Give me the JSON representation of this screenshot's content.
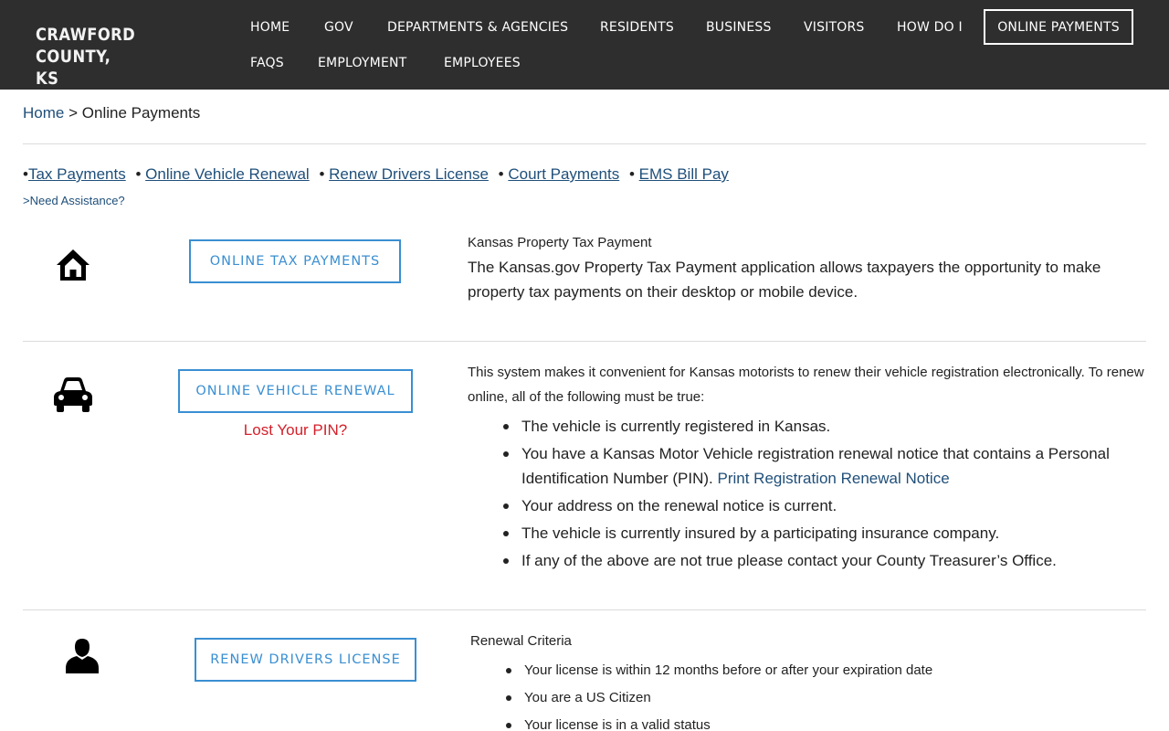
{
  "header": {
    "logo_line1": "CRAWFORD COUNTY,",
    "logo_line2": "KS",
    "nav": [
      "HOME",
      "GOV",
      "DEPARTMENTS & AGENCIES",
      "RESIDENTS",
      "BUSINESS",
      "VISITORS",
      "HOW DO I",
      "FAQS",
      "EMPLOYMENT",
      "EMPLOYEES"
    ],
    "nav_highlight": "ONLINE PAYMENTS"
  },
  "breadcrumb": {
    "home": "Home",
    "sep": ">",
    "current": "Online Payments"
  },
  "quicklinks": {
    "bullet": "•",
    "items": [
      "Tax Payments",
      "Online Vehicle Renewal",
      "Renew Drivers License",
      "Court Payments",
      "EMS Bill Pay"
    ],
    "assist": ">Need Assistance?"
  },
  "tax": {
    "icon": "home-icon",
    "button": "ONLINE TAX PAYMENTS",
    "heading": "Kansas Property Tax Payment",
    "body": "The Kansas.gov Property Tax Payment application allows taxpayers the opportunity to make property tax payments on their desktop or mobile device."
  },
  "vehicle": {
    "icon": "car-icon",
    "button": "ONLINE VEHICLE RENEWAL",
    "lost_pin": "Lost Your PIN?",
    "intro": "This system makes it convenient for Kansas motorists to renew their vehicle registration electronically.  To renew online, all of the following must be true:",
    "items": [
      "The vehicle is currently registered in Kansas.",
      "You have a Kansas Motor Vehicle registration renewal notice that contains a Personal Identification Number (PIN).",
      "Your address on the renewal notice is current.",
      "The vehicle is currently insured by a participating insurance company.",
      "If any of the above are not true please contact your County Treasurer’s Office."
    ],
    "print_link": "Print Registration Renewal Notice"
  },
  "license": {
    "icon": "person-icon",
    "button": "RENEW DRIVERS LICENSE",
    "heading": "Renewal Criteria",
    "items": [
      "Your license is within 12 months before or after your expiration date",
      "You are a US Citizen",
      "Your license is in a valid status"
    ]
  },
  "colors": {
    "header_bg": "#2e2e2e",
    "button_blue": "#3a8fd2",
    "link_blue": "#1f4f7a",
    "alert_red": "#d4202a"
  }
}
